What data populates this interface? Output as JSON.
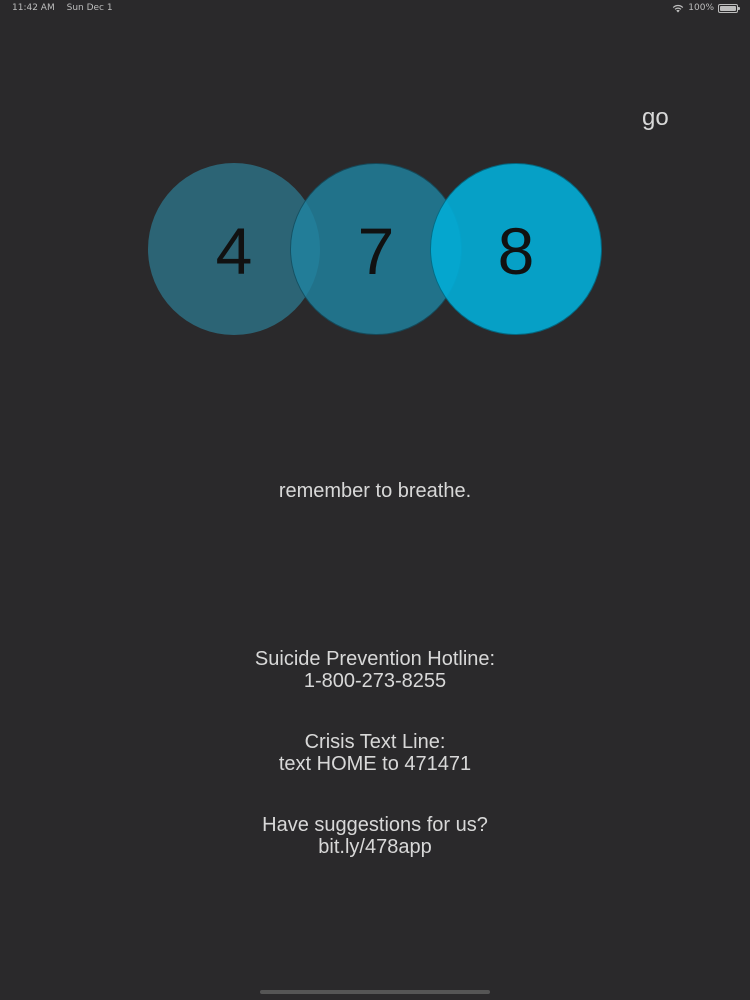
{
  "status_bar": {
    "time": "11:42 AM",
    "date": "Sun Dec 1",
    "battery_text": "100%",
    "battery_level": 1.0
  },
  "header": {
    "go_label": "go"
  },
  "circles": [
    {
      "digit": "4",
      "color": "#2d6e82"
    },
    {
      "digit": "7",
      "color": "#2082a0"
    },
    {
      "digit": "8",
      "color": "#03aad4"
    }
  ],
  "message": "remember to breathe.",
  "resources": {
    "hotline": {
      "title": "Suicide Prevention Hotline:",
      "detail": "1-800-273-8255"
    },
    "crisis": {
      "title": "Crisis Text Line:",
      "detail": "text HOME to 471471"
    },
    "suggestions": {
      "title": "Have suggestions for us?",
      "detail": "bit.ly/478app"
    }
  },
  "icons": {
    "wifi": "wifi-icon",
    "battery": "battery-icon"
  }
}
